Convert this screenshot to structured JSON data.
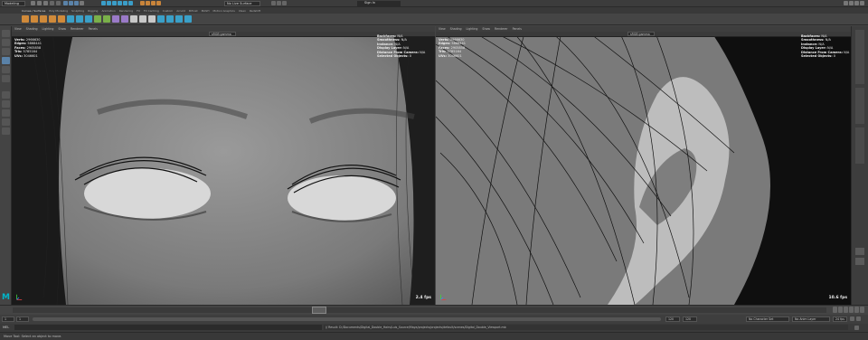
{
  "status_line": {
    "workspace": "Modeling",
    "menus": [
      "File",
      "Edit",
      "Create",
      "Select",
      "Modify",
      "Display",
      "Windows",
      "Mesh",
      "Edit Mesh",
      "Mesh Tools",
      "Mesh Display",
      "Curves",
      "Surfaces",
      "Deform",
      "UV",
      "Generate",
      "Cache",
      "Arnold",
      "Help"
    ],
    "no_live_surface": "No Live Surface",
    "sign_in": "Sign In"
  },
  "shelf_tabs": [
    "Curves / Surfaces",
    "Poly Modeling",
    "Sculpting",
    "Rigging",
    "Animation",
    "Rendering",
    "FX",
    "FX Caching",
    "Custom",
    "Arnold",
    "Bifrost",
    "MASH",
    "Motion Graphics",
    "XGen",
    "Redshift"
  ],
  "viewports": [
    {
      "menu": [
        "View",
        "Shading",
        "Lighting",
        "Show",
        "Renderer",
        "Panels"
      ],
      "hud_left": [
        {
          "label": "Verts:",
          "value": "2966630"
        },
        {
          "label": "Edges:",
          "value": "5868441"
        },
        {
          "label": "Faces:",
          "value": "2905858"
        },
        {
          "label": "Tris:",
          "value": "5785164"
        },
        {
          "label": "UVs:",
          "value": "3046601"
        }
      ],
      "hud_right": [
        {
          "label": "Backfaces:",
          "value": "N/A"
        },
        {
          "label": "Smoothness:",
          "value": "N/A"
        },
        {
          "label": "Instance:",
          "value": "N/A"
        },
        {
          "label": "Display Layer:",
          "value": "N/A"
        },
        {
          "label": "Distance From Camera:",
          "value": "N/A"
        },
        {
          "label": "Selected Objects:",
          "value": "0"
        }
      ],
      "fps": "2.4 fps",
      "color_space": "sRGB gamma"
    },
    {
      "menu": [
        "View",
        "Shading",
        "Lighting",
        "Show",
        "Renderer",
        "Panels"
      ],
      "hud_left": [
        {
          "label": "Verts:",
          "value": "2966630"
        },
        {
          "label": "Edges:",
          "value": "5868441"
        },
        {
          "label": "Faces:",
          "value": "2905858"
        },
        {
          "label": "Tris:",
          "value": "5785164"
        },
        {
          "label": "UVs:",
          "value": "3046601"
        }
      ],
      "hud_right": [
        {
          "label": "Backfaces:",
          "value": "N/A"
        },
        {
          "label": "Smoothness:",
          "value": "N/A"
        },
        {
          "label": "Instance:",
          "value": "N/A"
        },
        {
          "label": "Display Layer:",
          "value": "N/A"
        },
        {
          "label": "Distance From Camera:",
          "value": "N/A"
        },
        {
          "label": "Selected Objects:",
          "value": "0"
        }
      ],
      "fps": "10.6 fps",
      "color_space": "sRGB gamma"
    }
  ],
  "timeline": {
    "start": "1",
    "end": "120",
    "current": "1",
    "character_set": "No Character Set",
    "anim_layer": "No Anim Layer",
    "fps_setting": "24 fps"
  },
  "command_line": {
    "label": "MEL",
    "result": "// Result: D:/Documents/Digital_Double_Hairs/Luis_Source/Maya/projects/projects/default/scenes/Digital_Double_Viewport.mb"
  },
  "help_line": {
    "text": "Move Tool: Select an object to move."
  },
  "colors": {
    "accent": "#5a82a8",
    "logo": "#00b4c8"
  }
}
